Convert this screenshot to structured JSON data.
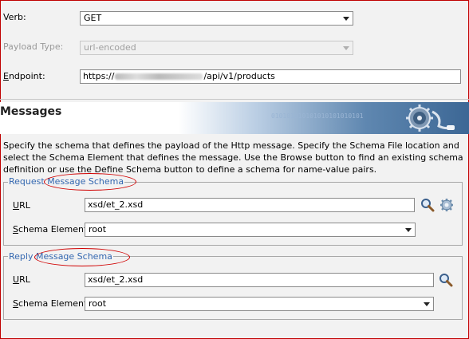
{
  "form": {
    "verb": {
      "label": "Verb:",
      "value": "GET"
    },
    "payload": {
      "label": "Payload Type:",
      "value": "url-encoded"
    },
    "endpoint": {
      "label": "Endpoint:",
      "value_prefix": "https://",
      "value_suffix": "/api/v1/products"
    }
  },
  "messages": {
    "title": "Messages",
    "binary_text": "010101010101010101010101",
    "description": "Specify the schema that defines the payload of the Http message.  Specify the Schema File location and select the Schema Element that defines the message. Use the Browse button to find an existing schema definition or use the Define Schema button to define a schema for name-value pairs."
  },
  "request": {
    "title_plain": "Request ",
    "title_highlight": "Message Schema",
    "url_label": "URL",
    "url_value": "xsd/et_2.xsd",
    "element_label": "Schema Element",
    "element_value": "root"
  },
  "reply": {
    "title_plain": "Reply ",
    "title_highlight": "Message Schema",
    "url_label": "URL",
    "url_value": "xsd/et_2.xsd",
    "element_label": "Schema Element",
    "element_value": "root"
  },
  "icons": {
    "browse": "search-icon",
    "define": "gear-icon"
  },
  "colors": {
    "accent": "#3367b0",
    "highlight_oval": "#d00000",
    "frame_border": "#c00000"
  }
}
